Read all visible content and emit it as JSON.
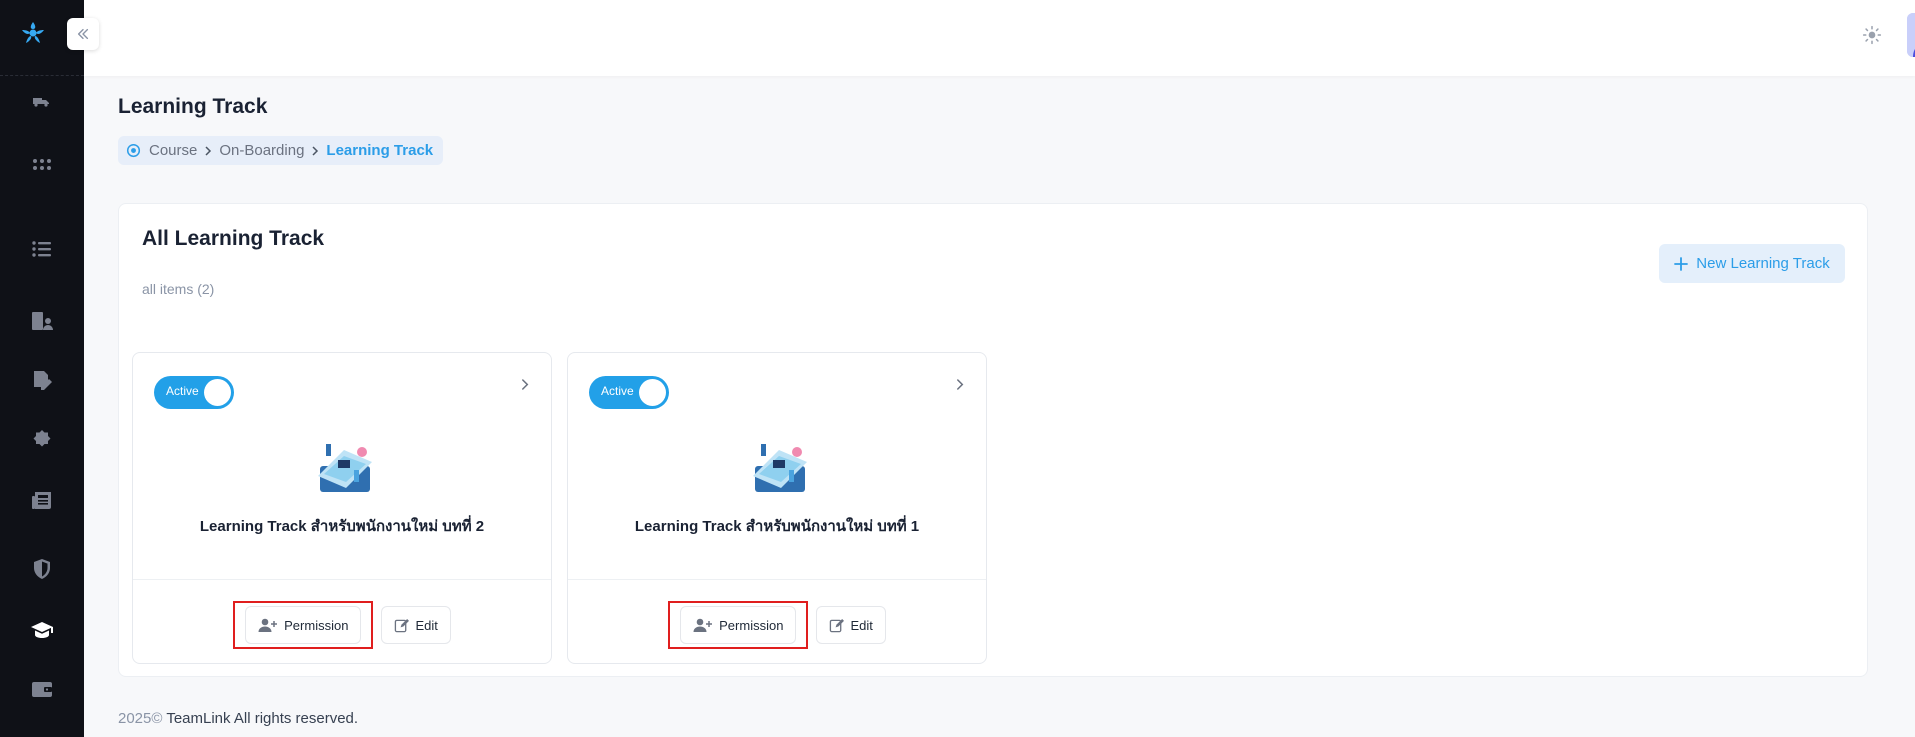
{
  "header": {
    "theme_icon": "sun-icon",
    "avatar_icon": "user-avatar"
  },
  "sidebar": {
    "logo_icon": "teamlink-logo",
    "items": [
      {
        "icon": "truck-icon",
        "active": false
      },
      {
        "icon": "grid-icon",
        "active": false
      },
      {
        "icon": "list-icon",
        "active": false
      },
      {
        "icon": "building-user-icon",
        "active": false
      },
      {
        "icon": "signature-icon",
        "active": false
      },
      {
        "icon": "badge-icon",
        "active": false
      },
      {
        "icon": "newspaper-icon",
        "active": false
      },
      {
        "icon": "shield-icon",
        "active": false
      },
      {
        "icon": "graduation-cap-icon",
        "active": true
      },
      {
        "icon": "wallet-icon",
        "active": false
      }
    ]
  },
  "page": {
    "title": "Learning Track",
    "breadcrumb": {
      "items": [
        "Course",
        "On-Boarding",
        "Learning Track"
      ]
    }
  },
  "main": {
    "section_title": "All Learning Track",
    "count": "all items (2)",
    "new_button": "New Learning Track",
    "cards": [
      {
        "status": "Active",
        "title": "Learning Track สำหรับพนักงานใหม่ บทที่ 2",
        "permission_label": "Permission",
        "edit_label": "Edit"
      },
      {
        "status": "Active",
        "title": "Learning Track สำหรับพนักงานใหม่ บทที่ 1",
        "permission_label": "Permission",
        "edit_label": "Edit"
      }
    ]
  },
  "footer": {
    "year": "2025©",
    "text": " TeamLink All rights reserved."
  },
  "colors": {
    "accent": "#22a0e8",
    "sidebar_bg": "#0f1117",
    "highlight": "#e01e1e"
  }
}
